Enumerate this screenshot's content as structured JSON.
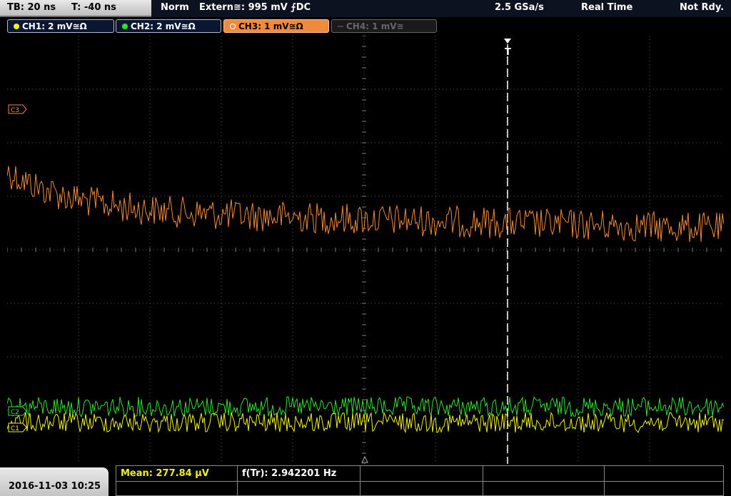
{
  "status_bar": {
    "tb": "TB: 20 ns",
    "trigger_time": "T: -40 ns",
    "mode": "Norm",
    "trigger": "Extern≅: 995 mV ⨍DC",
    "sample_rate": "2.5 GSa/s",
    "acq_mode": "Real Time",
    "state": "Not Rdy."
  },
  "channels": [
    {
      "label": "CH1: 2 mV≅Ω",
      "color": "#f0f020",
      "enabled": true
    },
    {
      "label": "CH2: 2 mV≅Ω",
      "color": "#30e030",
      "enabled": true
    },
    {
      "label": "CH3: 1 mV≅Ω",
      "color": "#f08a3c",
      "enabled": true,
      "selected": true
    },
    {
      "label": "CH4: 1 mV≅",
      "color": "#666666",
      "enabled": false
    }
  ],
  "markers": {
    "c3": "C3",
    "c2": "C2",
    "c1": "C1",
    "trigger": "T"
  },
  "bottom": {
    "date": "2016-11-03 10:25",
    "mean": "Mean: 277.84 µV",
    "freq": "f(Tr): 2.942201 Hz"
  },
  "colors": {
    "ch1": "#f0f020",
    "ch2": "#30e030",
    "ch3": "#f08a3c",
    "grid": "#555555"
  }
}
